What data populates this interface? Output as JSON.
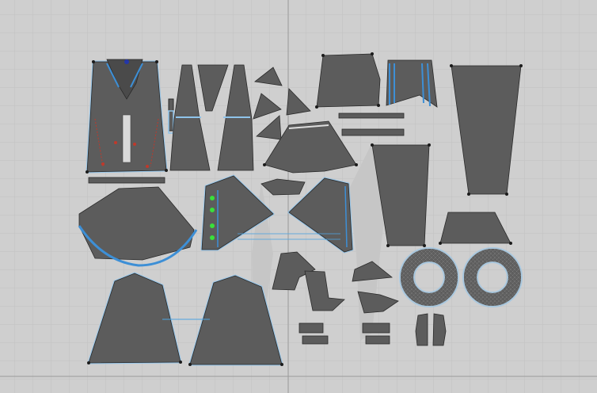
{
  "view": {
    "mode": "uv-pattern-layout",
    "background": "#cfcfcf",
    "grid_color": "#bcbcbc",
    "axis_color": "#9a9a9a"
  },
  "pattern": {
    "piece_fill": "#5c5c5c",
    "piece_stroke": "#2a2a2a",
    "mesh_color": "#8a8a8a",
    "selection_outline": "#8fc3ea",
    "seam_highlight": "#3d8fd6",
    "pin_color_green": "#39e03a",
    "pin_color_red": "#c0392b",
    "pin_color_blue": "#2436a8"
  }
}
